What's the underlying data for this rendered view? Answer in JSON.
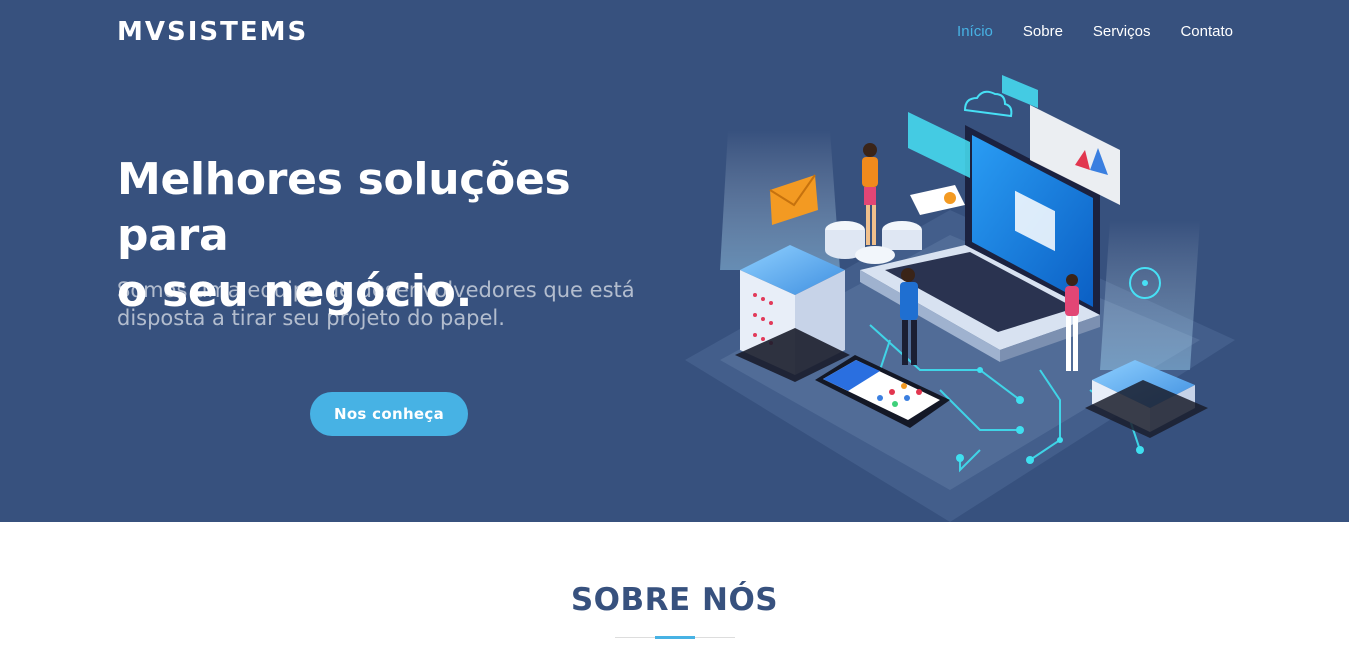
{
  "header": {
    "logo": "MVSISTEMS",
    "nav": [
      {
        "label": "Início",
        "active": true
      },
      {
        "label": "Sobre",
        "active": false
      },
      {
        "label": "Serviços",
        "active": false
      },
      {
        "label": "Contato",
        "active": false
      }
    ]
  },
  "hero": {
    "headline_line1": "Melhores soluções para",
    "headline_line2": "o seu negócio.",
    "subhead_line1": "Somos uma equipe de desenvolvedores que está",
    "subhead_line2": "disposta a tirar seu projeto do papel.",
    "cta_label": "Nos conheça",
    "illustration_icon": "tech-isometric-illustration"
  },
  "about": {
    "title": "SOBRE NÓS"
  },
  "colors": {
    "hero_bg": "#37517e",
    "accent": "#47b2e4",
    "title": "#37517e",
    "white": "#ffffff"
  }
}
